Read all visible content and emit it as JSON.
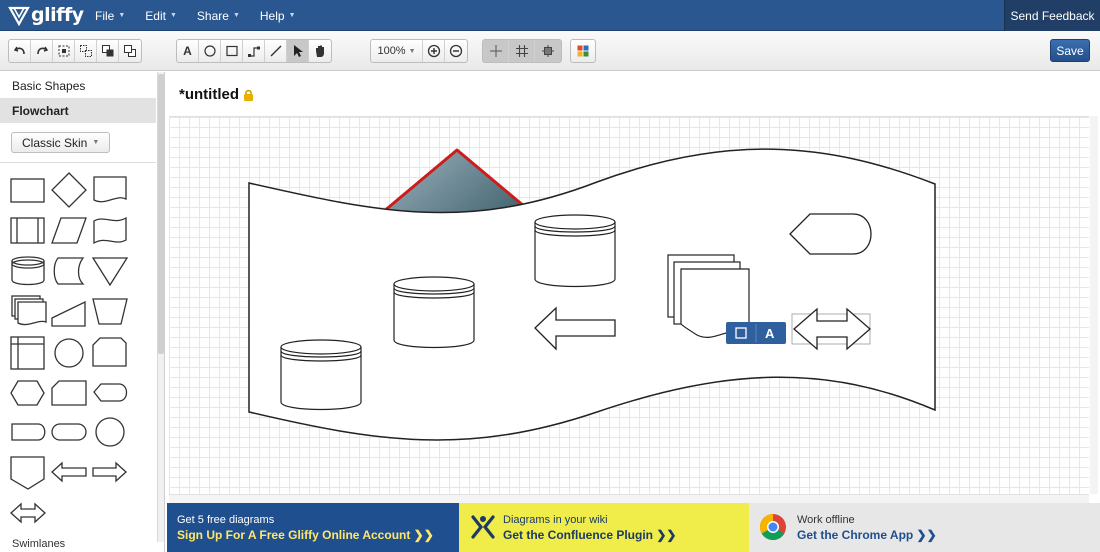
{
  "app": {
    "logo_text": "gliffy"
  },
  "menu": {
    "items": [
      {
        "label": "File"
      },
      {
        "label": "Edit"
      },
      {
        "label": "Share"
      },
      {
        "label": "Help"
      }
    ],
    "feedback_label": "Send Feedback"
  },
  "toolbar": {
    "zoom": "100%",
    "text_tool": "A",
    "save_label": "Save"
  },
  "palette": {
    "sections": [
      {
        "label": "Basic Shapes",
        "selected": false
      },
      {
        "label": "Flowchart",
        "selected": true
      }
    ],
    "skin_label": "Classic Skin",
    "cut_label": "Swimlanes"
  },
  "document": {
    "title": "*untitled"
  },
  "selection_toolbar": {
    "text_button": "A"
  },
  "promos": [
    {
      "line1": "Get 5 free diagrams",
      "line2": "Sign Up For A Free Gliffy Online Account  ❯❯"
    },
    {
      "line1": "Diagrams in your wiki",
      "line2": "Get the Confluence Plugin  ❯❯"
    },
    {
      "line1": "Work offline",
      "line2": "Get the Chrome App  ❯❯"
    }
  ],
  "colors": {
    "brand_blue": "#2a578f",
    "selection_red": "#cc1d1d",
    "promo_yellow": "#f0ec4a"
  }
}
